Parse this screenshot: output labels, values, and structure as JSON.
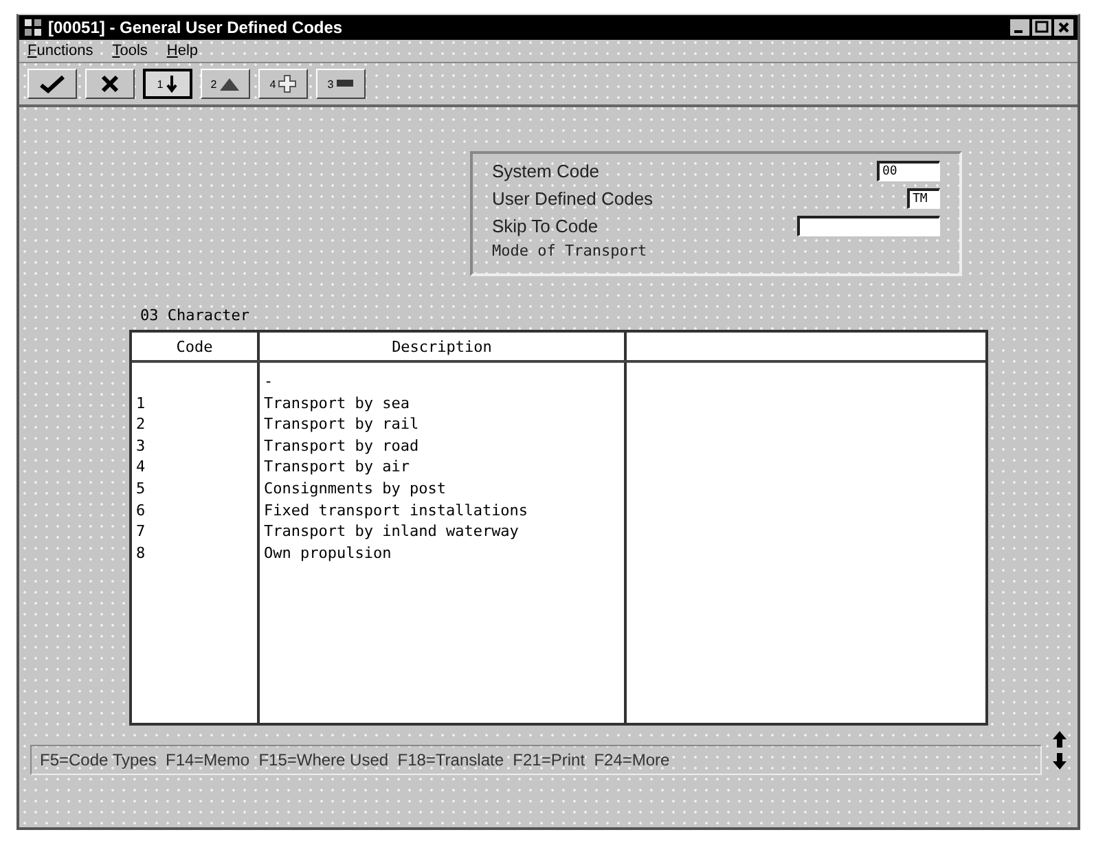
{
  "window": {
    "title": "[00051] - General User Defined Codes"
  },
  "menu": [
    "Functions",
    "Tools",
    "Help"
  ],
  "toolbar": [
    {
      "kind": "check",
      "selected": false
    },
    {
      "kind": "cancel",
      "selected": false
    },
    {
      "kind": "find",
      "key": "1",
      "selected": true
    },
    {
      "kind": "triangle",
      "key": "2",
      "selected": false
    },
    {
      "kind": "plus",
      "key": "4",
      "selected": false
    },
    {
      "kind": "bar",
      "key": "3",
      "selected": false
    }
  ],
  "header": {
    "fields": [
      {
        "label": "System Code",
        "value": "00"
      },
      {
        "label": "User Defined Codes",
        "value": "TM"
      },
      {
        "label": "Skip To Code"
      }
    ],
    "description": "Mode of Transport"
  },
  "table": {
    "caption": "03 Character",
    "columns": [
      "Code",
      "Description",
      ""
    ],
    "rows": [
      {
        "code": "",
        "description": "-"
      },
      {
        "code": "1",
        "description": "Transport by sea"
      },
      {
        "code": "2",
        "description": "Transport by rail"
      },
      {
        "code": "3",
        "description": "Transport by road"
      },
      {
        "code": "4",
        "description": "Transport by air"
      },
      {
        "code": "5",
        "description": "Consignments by post"
      },
      {
        "code": "6",
        "description": "Fixed transport installations"
      },
      {
        "code": "7",
        "description": "Transport by inland waterway"
      },
      {
        "code": "8",
        "description": "Own propulsion"
      }
    ]
  },
  "status_bar": "F5=Code Types  F14=Memo  F15=Where Used  F18=Translate  F21=Print  F24=More"
}
